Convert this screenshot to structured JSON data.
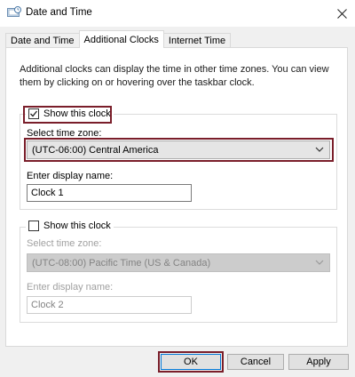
{
  "window": {
    "title": "Date and Time"
  },
  "tabs": [
    {
      "label": "Date and Time",
      "active": false
    },
    {
      "label": "Additional Clocks",
      "active": true
    },
    {
      "label": "Internet Time",
      "active": false
    }
  ],
  "description": "Additional clocks can display the time in other time zones. You can view them by clicking on or hovering over the taskbar clock.",
  "clock1": {
    "show_label": "Show this clock",
    "checked": true,
    "timezone_label": "Select time zone:",
    "timezone_value": "(UTC-06:00) Central America",
    "display_name_label": "Enter display name:",
    "display_name_value": "Clock 1"
  },
  "clock2": {
    "show_label": "Show this clock",
    "checked": false,
    "timezone_label": "Select time zone:",
    "timezone_value": "(UTC-08:00) Pacific Time (US & Canada)",
    "display_name_label": "Enter display name:",
    "display_name_value": "Clock 2"
  },
  "buttons": {
    "ok": "OK",
    "cancel": "Cancel",
    "apply": "Apply"
  },
  "colors": {
    "highlight": "#7a1e2a",
    "focus_blue": "#0078d7"
  }
}
